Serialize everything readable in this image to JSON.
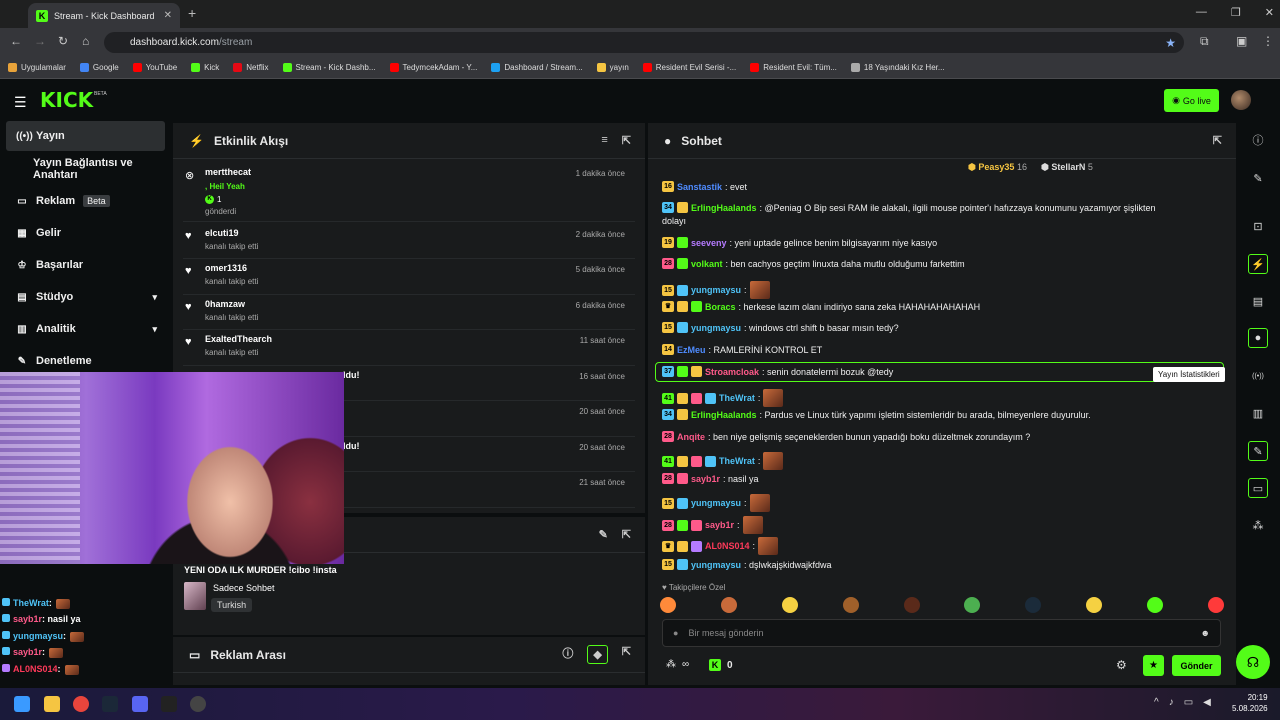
{
  "browser": {
    "tab_title": "Stream - Kick Dashboard",
    "url_host": "dashboard.kick.com",
    "url_path": "/stream",
    "bookmarks": [
      {
        "label": "Uygulamalar",
        "color": "#e8a33a"
      },
      {
        "label": "Google",
        "color": "#4285f4"
      },
      {
        "label": "YouTube",
        "color": "#ff0000"
      },
      {
        "label": "Kick",
        "color": "#53fc18"
      },
      {
        "label": "Netflix",
        "color": "#e50914"
      },
      {
        "label": "Stream - Kick Dashb...",
        "color": "#53fc18"
      },
      {
        "label": "TedymcekAdam - Y...",
        "color": "#ff0000"
      },
      {
        "label": "Dashboard / Stream...",
        "color": "#1da1f2"
      },
      {
        "label": "yayın",
        "color": "#f5c542"
      },
      {
        "label": "Resident Evil Serisi -...",
        "color": "#ff0000"
      },
      {
        "label": "Resident Evil: Tüm...",
        "color": "#ff0000"
      },
      {
        "label": "18 Yaşındaki Kız Her...",
        "color": "#aaaaaa"
      }
    ]
  },
  "header": {
    "logo": "KICK",
    "logo_tag": "BETA",
    "go_live": "Go live",
    "accent": "#53fc18"
  },
  "sidebar": {
    "items": [
      {
        "label": "Yayın",
        "icon": "broadcast-icon",
        "glyph": "((•))"
      },
      {
        "label": "Yayın Bağlantısı ve Anahtarı",
        "icon": "",
        "glyph": ""
      },
      {
        "label": "Reklam",
        "icon": "ad-icon",
        "glyph": "▭",
        "badge": "Beta"
      },
      {
        "label": "Gelir",
        "icon": "revenue-icon",
        "glyph": "▦"
      },
      {
        "label": "Başarılar",
        "icon": "trophy-icon",
        "glyph": "♔"
      },
      {
        "label": "Stüdyo",
        "icon": "studio-icon",
        "glyph": "▤"
      },
      {
        "label": "Analitik",
        "icon": "analytics-icon",
        "glyph": "▥"
      },
      {
        "label": "Denetleme",
        "icon": "wrench-icon",
        "glyph": "✎"
      }
    ]
  },
  "activity": {
    "title": "Etkinlik Akışı",
    "events": [
      {
        "name": "mertthecat",
        "message": ", Heil Yeah",
        "amount": "1",
        "sub": "gönderdi",
        "time": "1 dakika önce",
        "icon": "kick-icon"
      },
      {
        "name": "elcuti19",
        "sub": "kanalı takip etti",
        "time": "2 dakika önce",
        "icon": "heart-icon"
      },
      {
        "name": "omer1316",
        "sub": "kanalı takip etti",
        "time": "5 dakika önce",
        "icon": "heart-icon"
      },
      {
        "name": "0hamzaw",
        "sub": "kanalı takip etti",
        "time": "6 dakika önce",
        "icon": "heart-icon"
      },
      {
        "name": "ExaltedThearch",
        "sub": "kanalı takip etti",
        "time": "11 saat önce",
        "icon": "heart-icon"
      },
      {
        "name": "ldu!",
        "sub": "",
        "time": "16 saat önce",
        "icon": ""
      },
      {
        "name": "",
        "sub": "",
        "time": "20 saat önce",
        "icon": ""
      },
      {
        "name": "ldu!",
        "sub": "",
        "time": "20 saat önce",
        "icon": ""
      },
      {
        "name": "",
        "sub": "",
        "time": "21 saat önce",
        "icon": ""
      }
    ]
  },
  "stream_info": {
    "title": "YENI ODA ILK MURDER !cibo !insta",
    "category": "Sadece Sohbet",
    "language": "Turkish"
  },
  "ad_break": {
    "title": "Reklam Arası"
  },
  "overlay_chat": [
    {
      "user": "TheWrat",
      "color": "#4fc3f7",
      "text": ":"
    },
    {
      "user": "sayb1r",
      "color": "#ff5a8a",
      "text": ": nasil ya"
    },
    {
      "user": "yungmaysu",
      "color": "#4fc3f7",
      "text": ":"
    },
    {
      "user": "sayb1r",
      "color": "#ff5a8a",
      "text": ":"
    },
    {
      "user": "AL0NS014",
      "color": "#ff3a5a",
      "text": ":"
    }
  ],
  "chat": {
    "title": "Sohbet",
    "top_gifters": [
      {
        "name": "Peasy35",
        "count": "16",
        "color": "#f5c542"
      },
      {
        "name": "StellarN",
        "count": "5",
        "color": "#dddddd"
      }
    ],
    "messages": [
      {
        "lvl": "16",
        "lvlc": "#f5c542",
        "badges": [],
        "user": "Sanstastik",
        "color": "#4f8cff",
        "text": ": evet"
      },
      {
        "lvl": "34",
        "lvlc": "#4fc3f7",
        "badges": [
          "#f5c542"
        ],
        "user": "ErlingHaalands",
        "color": "#53fc18",
        "text": ": @Peniag O Bip sesi RAM ile alakalı, ilgili mouse pointer'ı hafızzaya konumunu yazamıyor şişlikten"
      },
      {
        "lvl": "",
        "lvlc": "",
        "badges": [],
        "user": "",
        "color": "#f0f0f0",
        "text": "dolayı"
      },
      {
        "lvl": "19",
        "lvlc": "#f5c542",
        "badges": [
          "#53fc18"
        ],
        "user": "seeveny",
        "color": "#b57bff",
        "text": ": yeni uptade gelince benim bilgisayarım niye kasıyo"
      },
      {
        "lvl": "28",
        "lvlc": "#ff5a8a",
        "badges": [
          "#53fc18"
        ],
        "user": "volkant",
        "color": "#53fc18",
        "text": ": ben cachyos geçtim linuxta daha mutlu olduğumu farkettim"
      },
      {
        "lvl": "15",
        "lvlc": "#f5c542",
        "badges": [
          "#4fc3f7"
        ],
        "user": "yungmaysu",
        "color": "#4fc3f7",
        "text": ":"
      },
      {
        "lvl": "",
        "lvlc": "#f5c542",
        "badges": [
          "#f5c542",
          "#53fc18"
        ],
        "user": "Boracs",
        "color": "#53fc18",
        "text": ": herkese lazım olanı indiriyo sana zeka HAHAHAHAHAHAH"
      },
      {
        "lvl": "15",
        "lvlc": "#f5c542",
        "badges": [
          "#4fc3f7"
        ],
        "user": "yungmaysu",
        "color": "#4fc3f7",
        "text": ": windows ctrl shift b basar mısın tedy?"
      },
      {
        "lvl": "14",
        "lvlc": "#f5c542",
        "badges": [],
        "user": "EzMeu",
        "color": "#4f8cff",
        "text": ": RAMLERİNİ KONTROL ET"
      },
      {
        "lvl": "37",
        "lvlc": "#4fc3f7",
        "badges": [
          "#53fc18",
          "#f5c542"
        ],
        "user": "Stroamcloak",
        "color": "#ff5a8a",
        "text": ": senin donatelermi bozuk @tedy"
      },
      {
        "lvl": "41",
        "lvlc": "#53fc18",
        "badges": [
          "#f5c542",
          "#ff5a8a",
          "#4fc3f7"
        ],
        "user": "TheWrat",
        "color": "#4fc3f7",
        "text": ":"
      },
      {
        "lvl": "34",
        "lvlc": "#4fc3f7",
        "badges": [
          "#f5c542"
        ],
        "user": "ErlingHaalands",
        "color": "#53fc18",
        "text": ": Pardus ve Linux türk yapımı işletim sistemleridir bu arada, bilmeyenlere duyurulur."
      },
      {
        "lvl": "28",
        "lvlc": "#ff5a8a",
        "badges": [],
        "user": "Anqite",
        "color": "#ff5a8a",
        "text": ": ben niye gelişmiş seçeneklerden bunun yapadığı boku düzeltmek zorundayım ?"
      },
      {
        "lvl": "41",
        "lvlc": "#53fc18",
        "badges": [
          "#f5c542",
          "#ff5a8a",
          "#4fc3f7"
        ],
        "user": "TheWrat",
        "color": "#4fc3f7",
        "text": ":"
      },
      {
        "lvl": "28",
        "lvlc": "#ff5a8a",
        "badges": [
          "#ff5a8a"
        ],
        "user": "sayb1r",
        "color": "#ff5a8a",
        "text": ": nasil ya"
      },
      {
        "lvl": "15",
        "lvlc": "#f5c542",
        "badges": [
          "#4fc3f7"
        ],
        "user": "yungmaysu",
        "color": "#4fc3f7",
        "text": ":"
      },
      {
        "lvl": "28",
        "lvlc": "#ff5a8a",
        "badges": [
          "#53fc18",
          "#ff5a8a"
        ],
        "user": "sayb1r",
        "color": "#ff5a8a",
        "text": ":"
      },
      {
        "lvl": "",
        "lvlc": "#f5c542",
        "badges": [
          "#f5c542",
          "#b57bff"
        ],
        "user": "AL0NS014",
        "color": "#ff3a5a",
        "text": ":"
      },
      {
        "lvl": "15",
        "lvlc": "#f5c542",
        "badges": [
          "#4fc3f7"
        ],
        "user": "yungmaysu",
        "color": "#4fc3f7",
        "text": ": dşlwkajşkidwajkfdwa"
      }
    ],
    "followers_only": "Takipçilere Özel",
    "input_placeholder": "Bir mesaj gönderin",
    "viewers": "∞",
    "kicks": "0",
    "send": "Gönder",
    "tooltip": "Yayın İstatistikleri"
  },
  "taskbar": {
    "time": "20:19",
    "date": "5.08.2026"
  }
}
